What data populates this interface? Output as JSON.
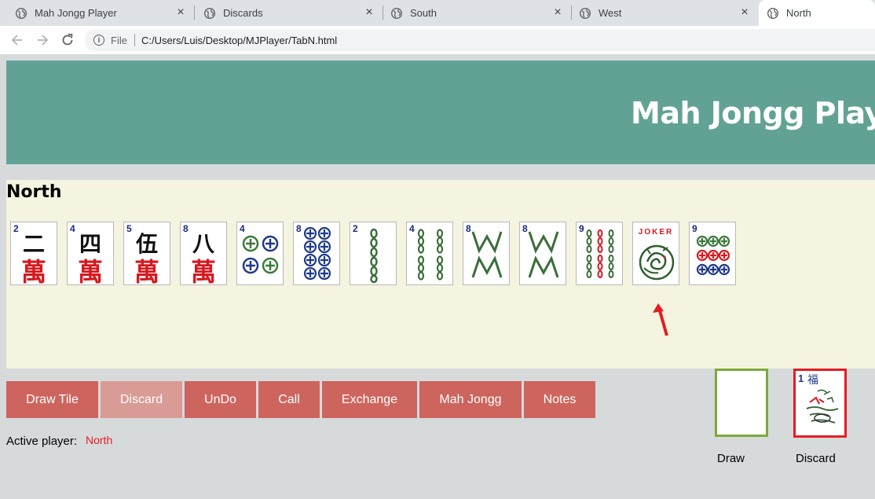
{
  "browser": {
    "tabs": [
      {
        "title": "Mah Jongg Player"
      },
      {
        "title": "Discards"
      },
      {
        "title": "South"
      },
      {
        "title": "West"
      },
      {
        "title": "North"
      }
    ],
    "active_tab": "North",
    "address": {
      "scheme": "File",
      "url": "C:/Users/Luis/Desktop/MJPlayer/TabN.html"
    }
  },
  "page": {
    "title": "Mah Jongg Player",
    "player_name": "North",
    "tiles": [
      {
        "name": "2-crak",
        "num": "2",
        "glyph": "二",
        "suit_glyph": "萬"
      },
      {
        "name": "4-crak",
        "num": "4",
        "glyph": "四",
        "suit_glyph": "萬"
      },
      {
        "name": "5-crak",
        "num": "5",
        "glyph": "伍",
        "suit_glyph": "萬"
      },
      {
        "name": "8-crak",
        "num": "8",
        "glyph": "八",
        "suit_glyph": "萬"
      },
      {
        "name": "4-dot",
        "num": "4"
      },
      {
        "name": "8-dot",
        "num": "8"
      },
      {
        "name": "2-bam",
        "num": "2"
      },
      {
        "name": "4-bam",
        "num": "4"
      },
      {
        "name": "8-bam-a",
        "num": "8"
      },
      {
        "name": "8-bam-b",
        "num": "8"
      },
      {
        "name": "9-bam",
        "num": "9"
      },
      {
        "name": "joker",
        "label": "JOKER"
      },
      {
        "name": "9-dot",
        "num": "9"
      }
    ],
    "buttons": {
      "draw_tile": "Draw Tile",
      "discard": "Discard",
      "undo": "UnDo",
      "call": "Call",
      "exchange": "Exchange",
      "mah_jongg": "Mah Jongg",
      "notes": "Notes"
    },
    "active_player_label": "Active player:",
    "active_player_value": "North",
    "draw_label": "Draw",
    "discard_label": "Discard",
    "discard_tile": {
      "num": "1",
      "glyph": "福"
    }
  },
  "colors": {
    "header_bg": "#62a295",
    "hand_bg": "#f4f4e0",
    "button_bg": "#cd655e",
    "button_disabled_bg": "#d99b96",
    "draw_border": "#7ba83c",
    "discard_border": "#e51c23",
    "active_player": "#e51c23"
  }
}
